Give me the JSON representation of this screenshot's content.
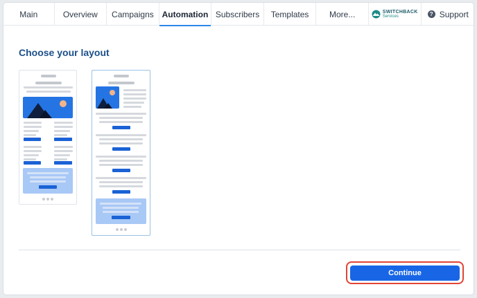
{
  "nav": {
    "tabs": [
      {
        "label": "Main"
      },
      {
        "label": "Overview"
      },
      {
        "label": "Campaigns"
      },
      {
        "label": "Automation",
        "active": true
      },
      {
        "label": "Subscribers"
      },
      {
        "label": "Templates"
      },
      {
        "label": "More..."
      }
    ],
    "logo": {
      "line1": "SWITCHBACK",
      "line2": "Services"
    },
    "support_label": "Support",
    "help_icon_glyph": "?"
  },
  "main": {
    "title": "Choose your layout",
    "layouts": [
      {
        "name": "two-column"
      },
      {
        "name": "single-column",
        "selected": true
      }
    ],
    "continue_label": "Continue"
  },
  "colors": {
    "accent": "#1866e6",
    "title": "#1c4f8a",
    "highlight": "#e04434"
  }
}
